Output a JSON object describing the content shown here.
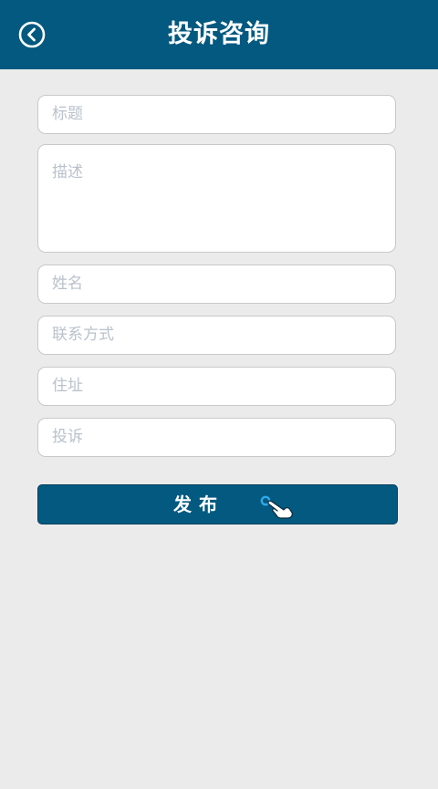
{
  "header": {
    "title": "投诉咨询",
    "back_icon": "chevron-left-circle-icon",
    "background": "#035980"
  },
  "form": {
    "title_placeholder": "标题",
    "description_placeholder": "描述",
    "name_placeholder": "姓名",
    "contact_placeholder": "联系方式",
    "address_placeholder": "住址",
    "complaint_placeholder": "投诉"
  },
  "submit": {
    "label": "发布",
    "icon": "tap-hand-icon",
    "background": "#035980"
  }
}
